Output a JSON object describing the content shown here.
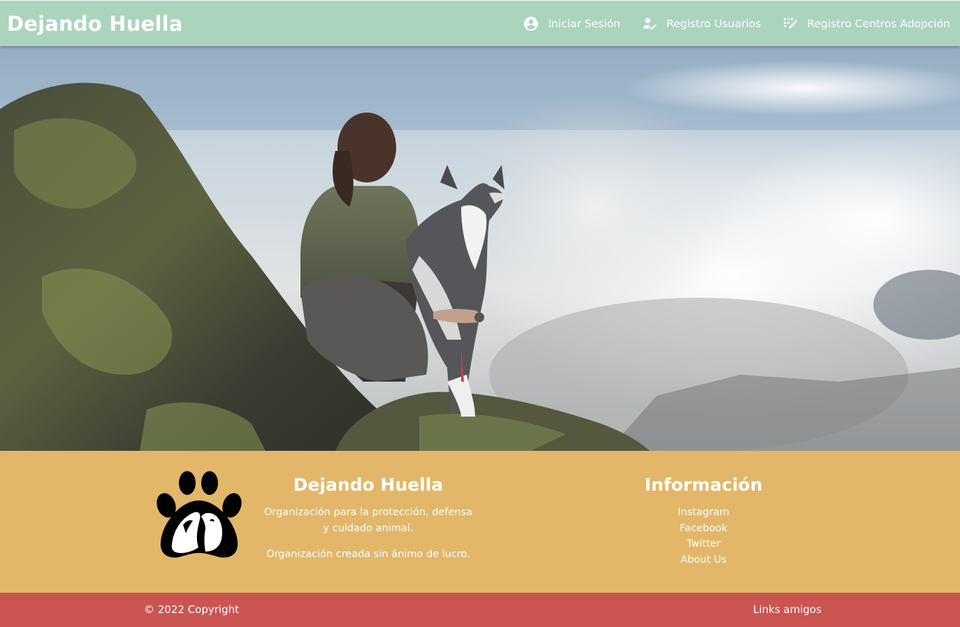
{
  "navbar": {
    "brand": "Dejando Huella",
    "links": [
      {
        "label": "Iniciar Sesión",
        "icon": "account-circle-icon"
      },
      {
        "label": "Registro Usuarios",
        "icon": "person-check-icon"
      },
      {
        "label": "Registro Centros Adopción",
        "icon": "edit-list-icon"
      }
    ]
  },
  "hero": {
    "image": "woman-with-husky-on-mountain-photo"
  },
  "footer": {
    "logo_icon": "paw-with-pets-icon",
    "about": {
      "title": "Dejando Huella",
      "text1": "Organización para la protección, defensa y cuidado animal.",
      "text2": "Organización creada sin ánimo de lucro."
    },
    "info": {
      "title": "Información",
      "links": [
        "Instagram",
        "Facebook",
        "Twitter",
        "About Us"
      ]
    }
  },
  "bottombar": {
    "copyright": "© 2022 Copyright",
    "friends_link": "Links amigos"
  },
  "colors": {
    "navbar": "#abd4bd",
    "footer": "#e2b769",
    "bottombar": "#cb5550",
    "text": "#ffffff"
  }
}
